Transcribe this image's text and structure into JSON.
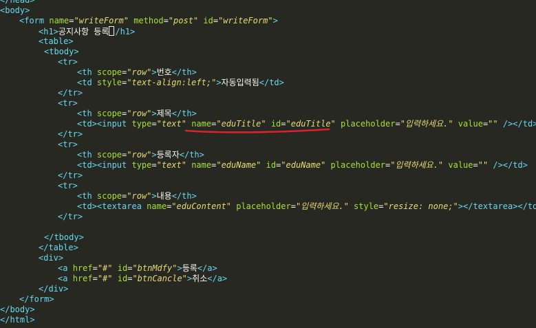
{
  "editor": {
    "lines": [
      [
        [
          "tag",
          "</head>"
        ]
      ],
      [
        [
          "tag",
          "<body>"
        ]
      ],
      [
        [
          "tag",
          "<form "
        ],
        [
          "attr",
          "name"
        ],
        [
          "punct",
          "="
        ],
        [
          "str",
          "\"writeForm\""
        ],
        [
          "attr",
          " method"
        ],
        [
          "punct",
          "="
        ],
        [
          "str",
          "\"post\""
        ],
        [
          "attr",
          " id"
        ],
        [
          "punct",
          "="
        ],
        [
          "str",
          "\"writeForm\""
        ],
        [
          "tag",
          ">"
        ]
      ],
      [
        [
          "tag",
          "<h1>"
        ],
        [
          "text",
          "공지사항 등록"
        ],
        [
          "cursor",
          ""
        ],
        [
          "tag",
          "/h1>"
        ]
      ],
      [
        [
          "tag",
          "<table>"
        ]
      ],
      [
        [
          "tag",
          "<tbody>"
        ]
      ],
      [
        [
          "tag",
          "<tr>"
        ]
      ],
      [
        [
          "tag",
          "<th "
        ],
        [
          "attr",
          "scope"
        ],
        [
          "punct",
          "="
        ],
        [
          "str",
          "\"row\""
        ],
        [
          "tag",
          ">"
        ],
        [
          "text",
          "번호"
        ],
        [
          "tag",
          "</th>"
        ]
      ],
      [
        [
          "tag",
          "<td "
        ],
        [
          "attr",
          "style"
        ],
        [
          "punct",
          "="
        ],
        [
          "str",
          "\"text-align:left;\""
        ],
        [
          "tag",
          ">"
        ],
        [
          "text",
          "자동입력됨"
        ],
        [
          "tag",
          "</td>"
        ]
      ],
      [
        [
          "tag",
          "</tr>"
        ]
      ],
      [
        [
          "tag",
          "<tr>"
        ]
      ],
      [
        [
          "tag",
          "<th "
        ],
        [
          "attr",
          "scope"
        ],
        [
          "punct",
          "="
        ],
        [
          "str",
          "\"row\""
        ],
        [
          "tag",
          ">"
        ],
        [
          "text",
          "제목"
        ],
        [
          "tag",
          "</th>"
        ]
      ],
      [
        [
          "tag",
          "<td><input "
        ],
        [
          "attr",
          "type"
        ],
        [
          "punct",
          "="
        ],
        [
          "str",
          "\"text\""
        ],
        [
          "attr",
          " name"
        ],
        [
          "punct",
          "="
        ],
        [
          "str",
          "\"eduTitle\""
        ],
        [
          "attr",
          " id"
        ],
        [
          "punct",
          "="
        ],
        [
          "str",
          "\"eduTitle\""
        ],
        [
          "attr",
          " placeholder"
        ],
        [
          "punct",
          "="
        ],
        [
          "str",
          "\"입력하세요.\""
        ],
        [
          "attr",
          " value"
        ],
        [
          "punct",
          "="
        ],
        [
          "str",
          "\"\""
        ],
        [
          "tag",
          " /></td>"
        ]
      ],
      [
        [
          "tag",
          "</tr>"
        ]
      ],
      [
        [
          "tag",
          "<tr>"
        ]
      ],
      [
        [
          "tag",
          "<th "
        ],
        [
          "attr",
          "scope"
        ],
        [
          "punct",
          "="
        ],
        [
          "str",
          "\"row\""
        ],
        [
          "tag",
          ">"
        ],
        [
          "text",
          "등록자"
        ],
        [
          "tag",
          "</th>"
        ]
      ],
      [
        [
          "tag",
          "<td><input "
        ],
        [
          "attr",
          "type"
        ],
        [
          "punct",
          "="
        ],
        [
          "str",
          "\"text\""
        ],
        [
          "attr",
          " name"
        ],
        [
          "punct",
          "="
        ],
        [
          "str",
          "\"eduName\""
        ],
        [
          "attr",
          " id"
        ],
        [
          "punct",
          "="
        ],
        [
          "str",
          "\"eduName\""
        ],
        [
          "attr",
          " placeholder"
        ],
        [
          "punct",
          "="
        ],
        [
          "str",
          "\"입력하세요.\""
        ],
        [
          "attr",
          " value"
        ],
        [
          "punct",
          "="
        ],
        [
          "str",
          "\"\""
        ],
        [
          "tag",
          " /></td>"
        ]
      ],
      [
        [
          "tag",
          "</tr>"
        ]
      ],
      [
        [
          "tag",
          "<tr>"
        ]
      ],
      [
        [
          "tag",
          "<th "
        ],
        [
          "attr",
          "scope"
        ],
        [
          "punct",
          "="
        ],
        [
          "str",
          "\"row\""
        ],
        [
          "tag",
          ">"
        ],
        [
          "text",
          "내용"
        ],
        [
          "tag",
          "</th>"
        ]
      ],
      [
        [
          "tag",
          "<td><textarea "
        ],
        [
          "attr",
          "name"
        ],
        [
          "punct",
          "="
        ],
        [
          "str",
          "\"eduContent\""
        ],
        [
          "attr",
          " placeholder"
        ],
        [
          "punct",
          "="
        ],
        [
          "str",
          "\"입력하세요.\""
        ],
        [
          "attr",
          " style"
        ],
        [
          "punct",
          "="
        ],
        [
          "str",
          "\"resize: none;\""
        ],
        [
          "tag",
          "></textarea></td>"
        ]
      ],
      [
        [
          "tag",
          "</tr>"
        ]
      ],
      [],
      [
        [
          "tag",
          "</tbody>"
        ]
      ],
      [
        [
          "tag",
          "</table>"
        ]
      ],
      [
        [
          "tag",
          "<div>"
        ]
      ],
      [
        [
          "tag",
          "<a "
        ],
        [
          "attr",
          "href"
        ],
        [
          "punct",
          "="
        ],
        [
          "str",
          "\"#\""
        ],
        [
          "attr",
          " id"
        ],
        [
          "punct",
          "="
        ],
        [
          "str",
          "\"btnMdfy\""
        ],
        [
          "tag",
          ">"
        ],
        [
          "text",
          "등록"
        ],
        [
          "tag",
          "</a>"
        ]
      ],
      [
        [
          "tag",
          "<a "
        ],
        [
          "attr",
          "href"
        ],
        [
          "punct",
          "="
        ],
        [
          "str",
          "\"#\""
        ],
        [
          "attr",
          " id"
        ],
        [
          "punct",
          "="
        ],
        [
          "str",
          "\"btnCancle\""
        ],
        [
          "tag",
          ">"
        ],
        [
          "text",
          "취소"
        ],
        [
          "tag",
          "</a>"
        ]
      ],
      [
        [
          "tag",
          "</div>"
        ]
      ],
      [
        [
          "tag",
          "</form>"
        ]
      ],
      [
        [
          "tag",
          "</body>"
        ]
      ],
      [
        [
          "tag",
          "</html>"
        ]
      ]
    ]
  },
  "annotation": {
    "color": "#e0202a"
  }
}
